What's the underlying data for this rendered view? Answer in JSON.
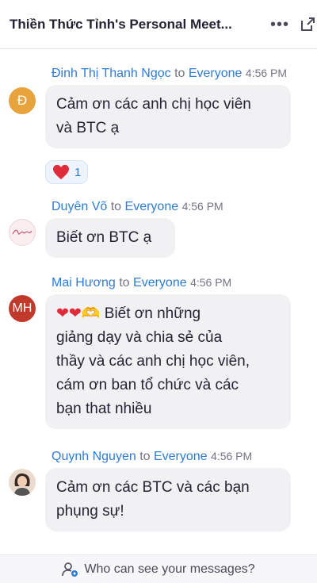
{
  "header": {
    "title": "Thiền Thức Tỉnh's Personal Meet...",
    "more_icon": "more-horizontal-icon",
    "popout_icon": "popout-icon"
  },
  "messages": [
    {
      "sender": "Đinh Thị Thanh Ngọc",
      "to_label": "to",
      "recipient": "Everyone",
      "time": "4:56 PM",
      "avatar_text": "Đ",
      "avatar_color": "#e8a33d",
      "lines": [
        "Cảm ơn các anh chị học viên",
        "và BTC ạ"
      ],
      "reaction": {
        "icon": "heart-icon",
        "count": "1"
      }
    },
    {
      "sender": "Duyên Võ",
      "to_label": "to",
      "recipient": "Everyone",
      "time": "4:56 PM",
      "avatar_text": "",
      "lines": [
        "Biết ơn BTC ạ"
      ]
    },
    {
      "sender": "Mai Hương",
      "to_label": "to",
      "recipient": "Everyone",
      "time": "4:56 PM",
      "avatar_text": "MH",
      "avatar_color": "#c0392b",
      "emoji_prefix": "❤❤🫶",
      "lines": [
        "Biết ơn những",
        "giảng dạy và chia sẻ của",
        "thầy và các anh chị học viên,",
        "cám ơn ban tổ chức và các",
        "bạn that nhiều"
      ]
    },
    {
      "sender": "Quynh Nguyen",
      "to_label": "to",
      "recipient": "Everyone",
      "time": "4:56 PM",
      "avatar_text": "",
      "lines": [
        "Cảm ơn các BTC và các bạn",
        "phụng sự!"
      ]
    }
  ],
  "footer": {
    "icon": "people-visibility-icon",
    "label": "Who can see your messages?"
  }
}
